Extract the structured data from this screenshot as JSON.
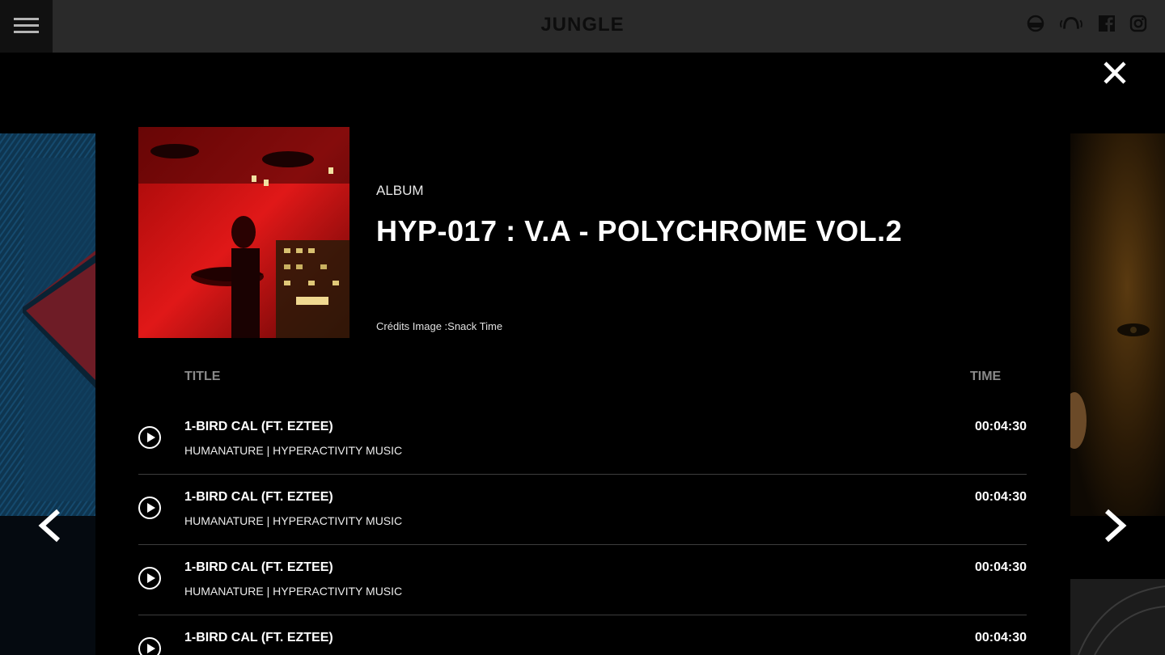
{
  "header": {
    "logo": "JUNGLE",
    "social_icons": [
      "soundcloud-icon",
      "mixcloud-icon",
      "facebook-icon",
      "instagram-icon"
    ]
  },
  "album": {
    "kind": "ALBUM",
    "title": "HYP-017 : V.A - POLYCHROME VOL.2",
    "credits": "Crédits Image :Snack Time"
  },
  "tracklist": {
    "col_title": "TITLE",
    "col_time": "TIME",
    "tracks": [
      {
        "title": "1-BIRD CAL (FT. EZTEE)",
        "artist": "HUMANATURE | HYPERACTIVITY MUSIC",
        "time": "00:04:30"
      },
      {
        "title": "1-BIRD CAL (FT. EZTEE)",
        "artist": "HUMANATURE | HYPERACTIVITY MUSIC",
        "time": "00:04:30"
      },
      {
        "title": "1-BIRD CAL (FT. EZTEE)",
        "artist": "HUMANATURE | HYPERACTIVITY MUSIC",
        "time": "00:04:30"
      },
      {
        "title": "1-BIRD CAL (FT. EZTEE)",
        "artist": "",
        "time": "00:04:30"
      }
    ]
  },
  "colors": {
    "background": "#000000",
    "topbar": "#2a2a2a",
    "menu_button": "#111111",
    "accent_red": "#d01010",
    "divider": "#3d3d3d"
  }
}
